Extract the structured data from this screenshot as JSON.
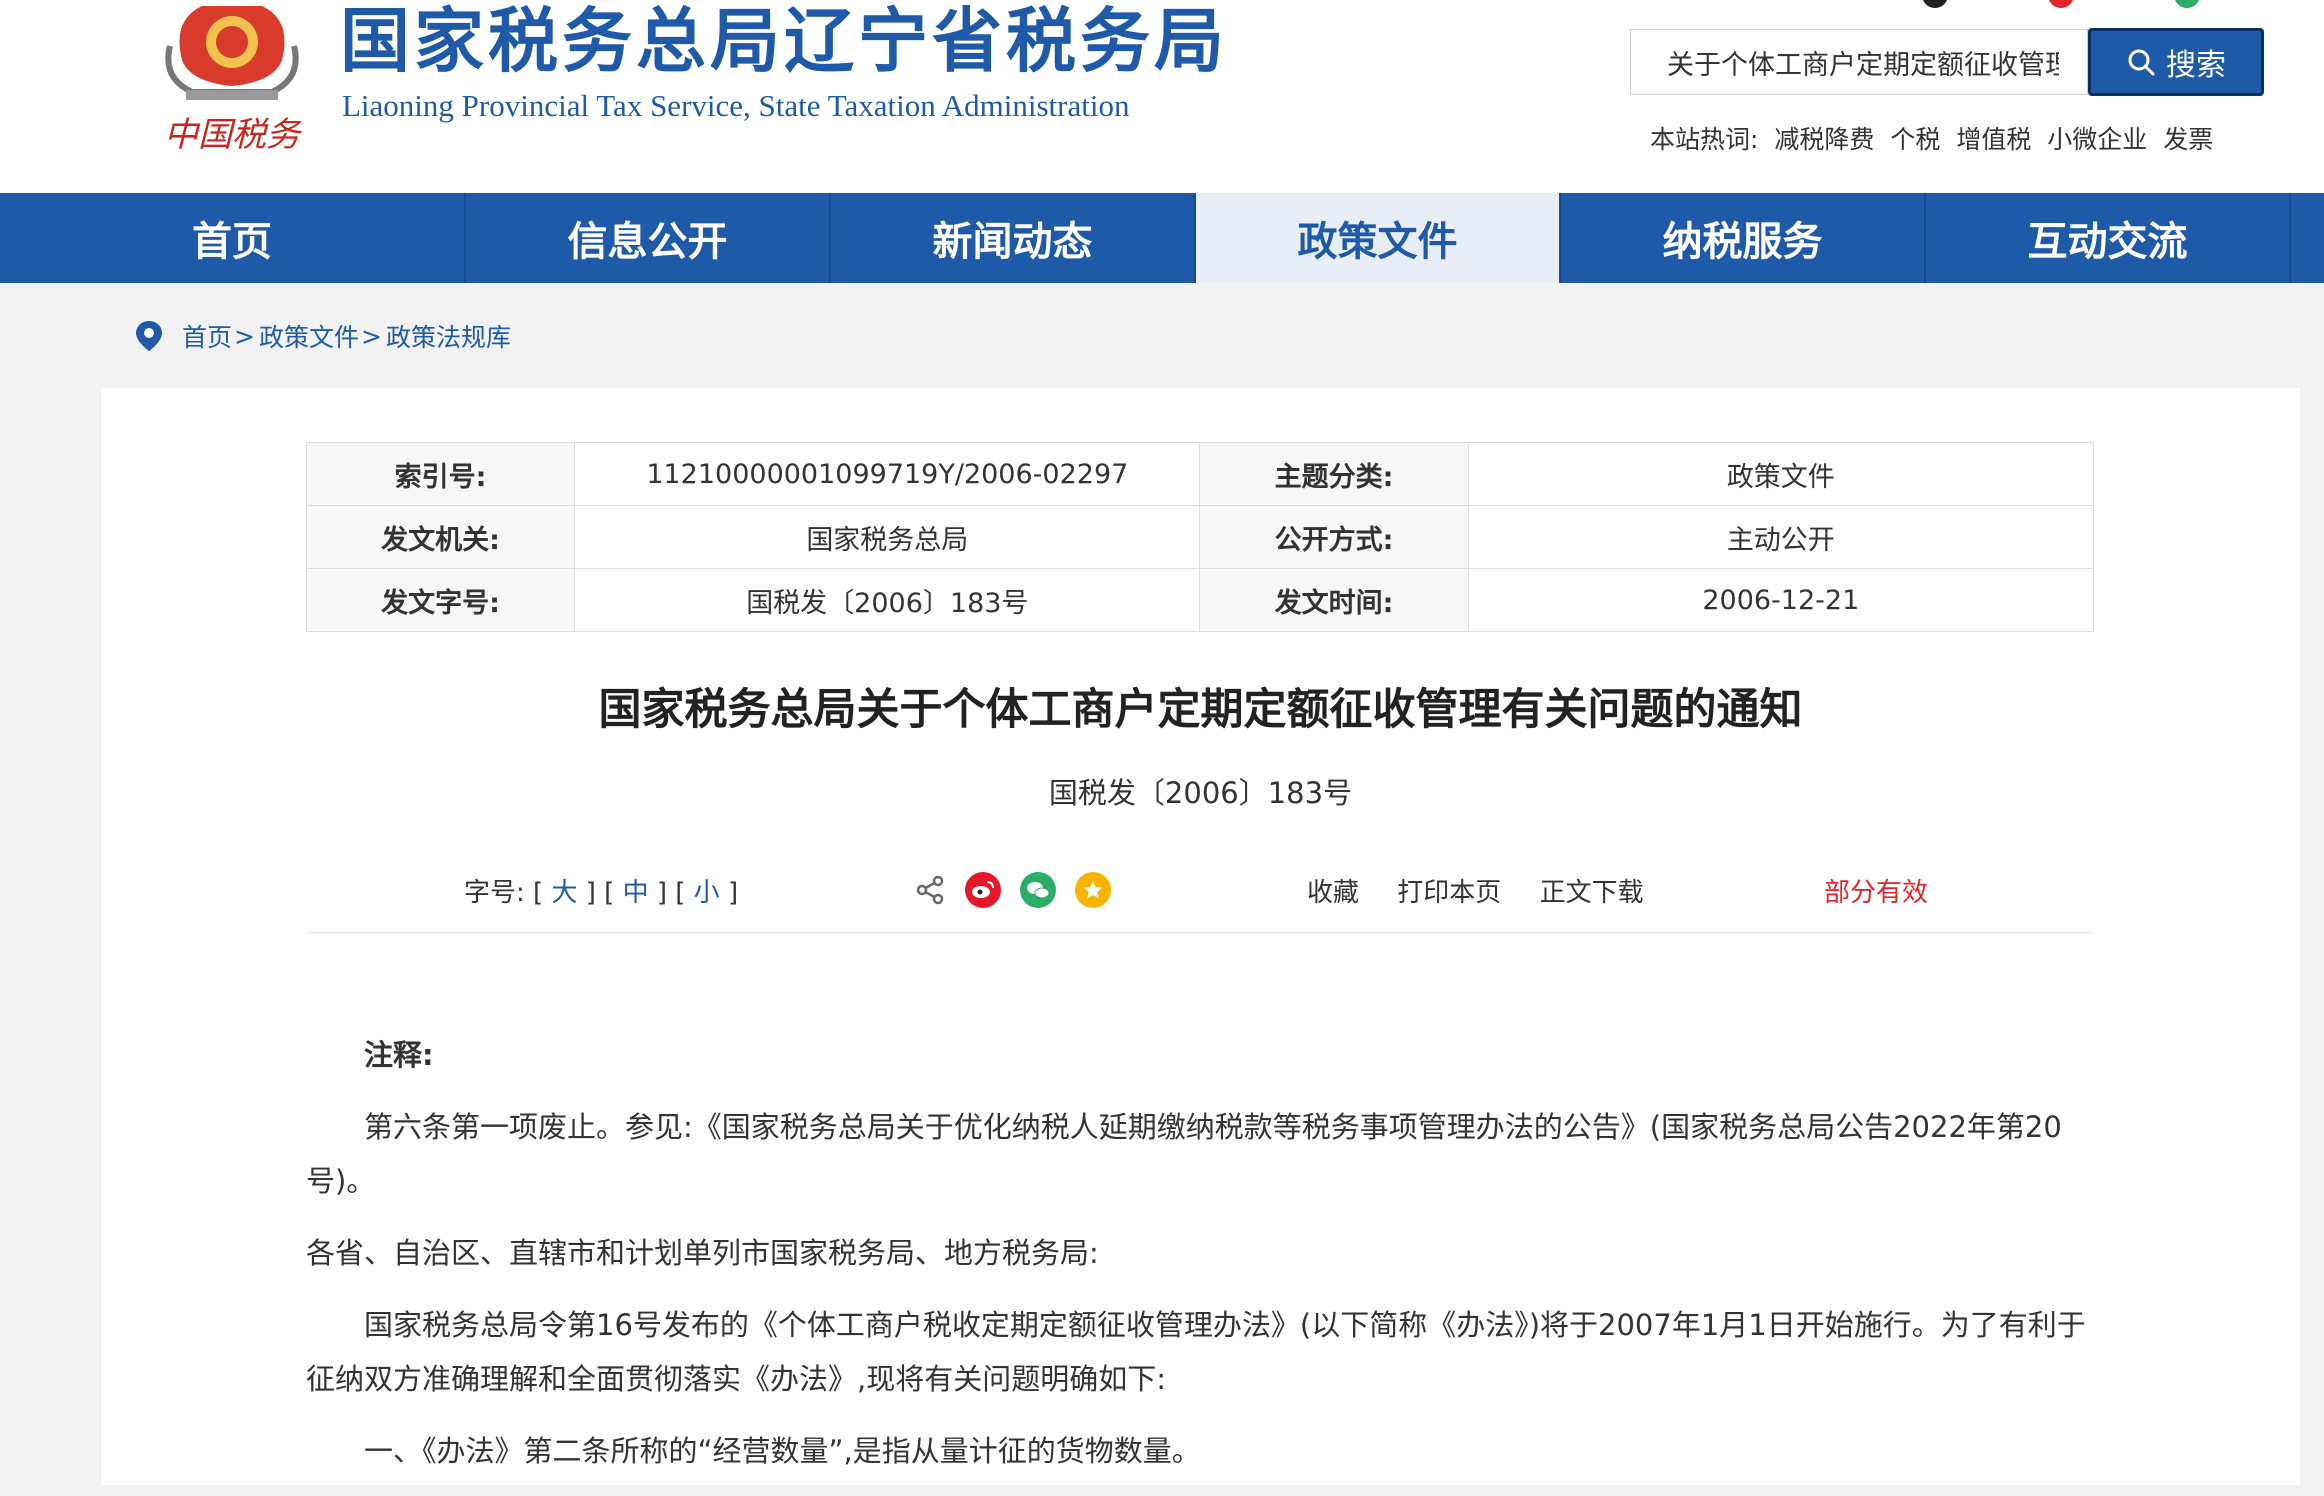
{
  "header": {
    "title_cn": "国家税务总局辽宁省税务局",
    "title_en": "Liaoning Provincial Tax Service, State Taxation Administration",
    "emblem_text": "中国税务",
    "search": {
      "value": "关于个体工商户定期定额征收管理",
      "button_label": "搜索"
    },
    "hot_label": "本站热词:",
    "hot_words": [
      "减税降费",
      "个税",
      "增值税",
      "小微企业",
      "发票"
    ]
  },
  "nav": {
    "items": [
      "首页",
      "信息公开",
      "新闻动态",
      "政策文件",
      "纳税服务",
      "互动交流"
    ],
    "active": "政策文件"
  },
  "breadcrumb": [
    "首页",
    "政策文件",
    "政策法规库"
  ],
  "meta": {
    "index_label": "索引号:",
    "index_value": "11210000001099719Y/2006-02297",
    "topic_label": "主题分类:",
    "topic_value": "政策文件",
    "issuer_label": "发文机关:",
    "issuer_value": "国家税务总局",
    "disclosure_label": "公开方式:",
    "disclosure_value": "主动公开",
    "docno_label": "发文字号:",
    "docno_value": "国税发〔2006〕183号",
    "date_label": "发文时间:",
    "date_value": "2006-12-21"
  },
  "doc": {
    "title": "国家税务总局关于个体工商户定期定额征收管理有关问题的通知",
    "number": "国税发〔2006〕183号"
  },
  "toolbar": {
    "font_label": "字号:",
    "font_large": "大",
    "font_medium": "中",
    "font_small": "小",
    "collect": "收藏",
    "print": "打印本页",
    "download": "正文下载",
    "status": "部分有效"
  },
  "body": {
    "note_heading": "注释:",
    "note": "第六条第一项废止。参见:《国家税务总局关于优化纳税人延期缴纳税款等税务事项管理办法的公告》(国家税务总局公告2022年第20号)。",
    "salutation": "各省、自治区、直辖市和计划单列市国家税务局、地方税务局:",
    "para1": "国家税务总局令第16号发布的《个体工商户税收定期定额征收管理办法》(以下简称《办法》)将于2007年1月1日开始施行。为了有利于征纳双方准确理解和全面贯彻落实《办法》,现将有关问题明确如下:",
    "para2": "一、《办法》第二条所称的“经营数量”,是指从量计征的货物数量。"
  },
  "colors": {
    "brand": "#1f5aa8",
    "status_red": "#e0262d",
    "weibo": "#e6162d",
    "wechat": "#2aae67",
    "star": "#f5b400"
  }
}
